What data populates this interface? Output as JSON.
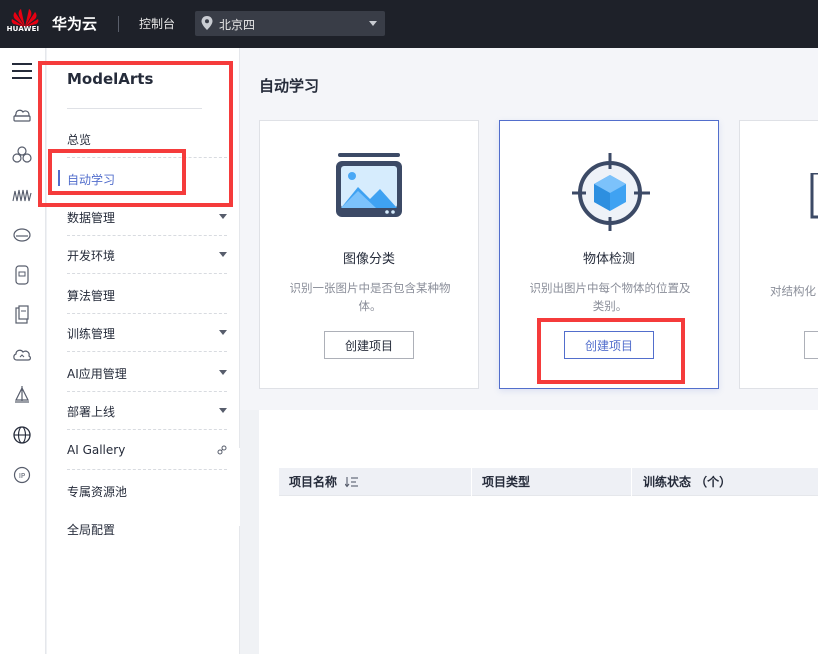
{
  "topbar": {
    "logo_text": "HUAWEI",
    "brand": "华为云",
    "console": "控制台",
    "region": "北京四"
  },
  "rail_icons": [
    "menu-icon",
    "cloud-server-icon",
    "nodes-icon",
    "waveform-icon",
    "disk-icon",
    "device-icon",
    "document-icon",
    "cloud-icon",
    "sail-icon",
    "globe-icon",
    "ip-icon"
  ],
  "sidebar": {
    "title": "ModelArts",
    "items": [
      {
        "label": "总览",
        "arrow": false
      },
      {
        "label": "自动学习",
        "arrow": false,
        "active": true
      },
      {
        "label": "数据管理",
        "arrow": true
      },
      {
        "label": "开发环境",
        "arrow": true
      },
      {
        "label": "算法管理",
        "arrow": false
      },
      {
        "label": "训练管理",
        "arrow": true
      },
      {
        "label": "AI应用管理",
        "arrow": true
      },
      {
        "label": "部署上线",
        "arrow": true
      },
      {
        "label": "AI Gallery",
        "arrow": false,
        "link": true
      },
      {
        "label": "专属资源池",
        "arrow": false
      },
      {
        "label": "全局配置",
        "arrow": false
      }
    ]
  },
  "main": {
    "title": "自动学习",
    "cards": [
      {
        "title": "图像分类",
        "desc": "识别一张图片中是否包含某种物体。",
        "button": "创建项目"
      },
      {
        "title": "物体检测",
        "desc": "识别出图片中每个物体的位置及类别。",
        "button": "创建项目"
      },
      {
        "title": "",
        "desc": "对结构化",
        "button": ""
      }
    ],
    "table": {
      "columns": [
        "项目名称",
        "项目类型",
        "训练状态 （个）"
      ]
    }
  },
  "colors": {
    "topbar": "#1e2129",
    "accent": "#526ecc",
    "highlight": "#f53b3b"
  }
}
